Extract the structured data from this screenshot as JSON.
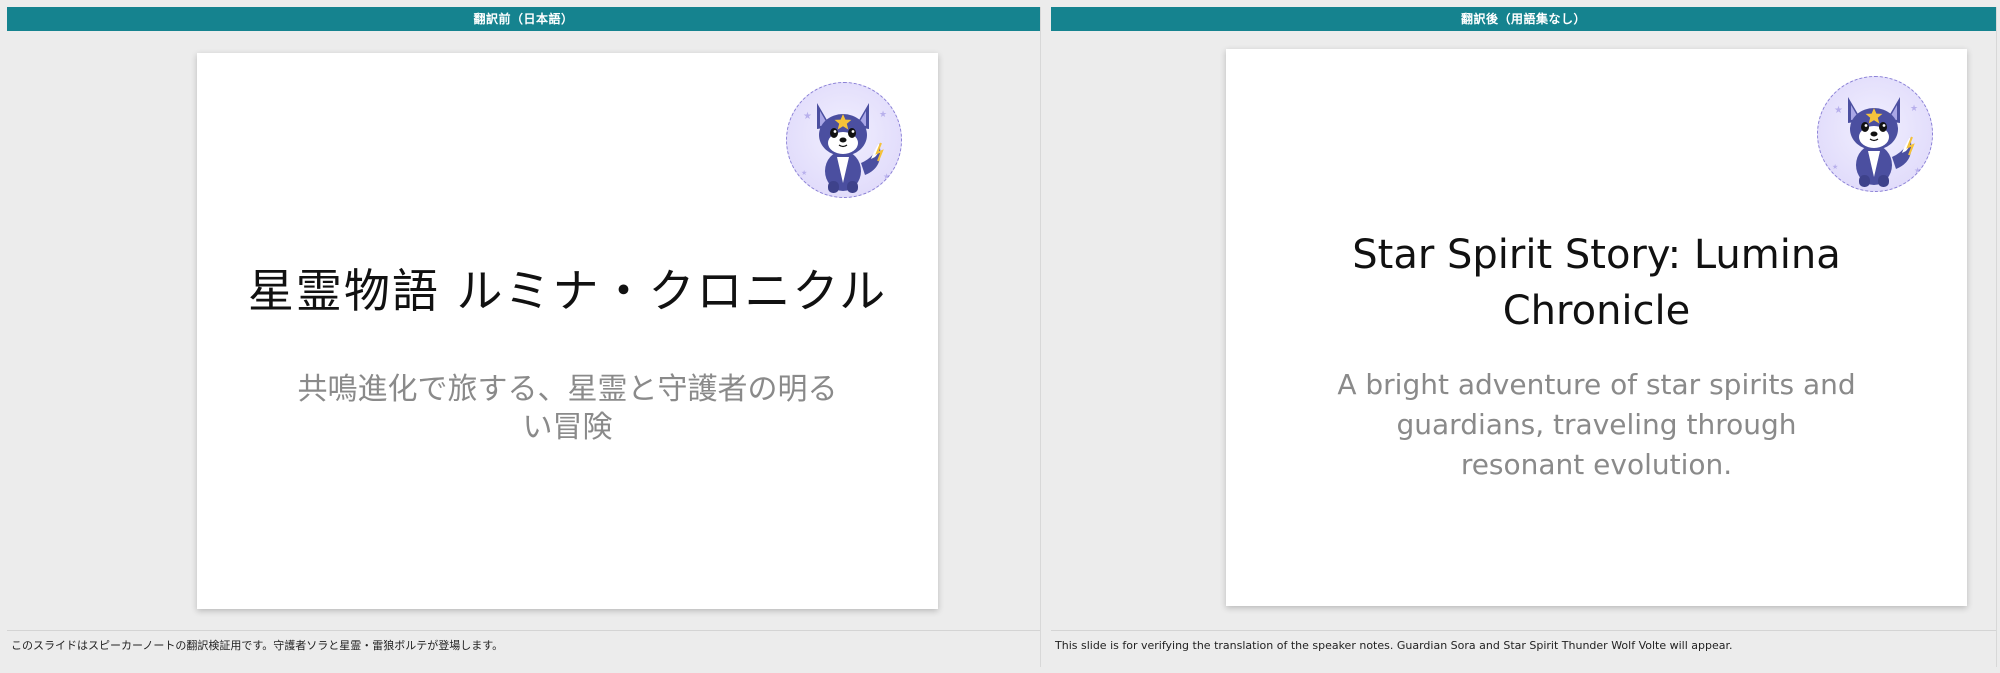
{
  "left_panel": {
    "header": "翻訳前（日本語）",
    "slide": {
      "title": "星霊物語 ルミナ・クロニクル",
      "subtitle": "共鳴進化で旅する、星霊と守護者の明るい冒険"
    },
    "notes": "このスライドはスピーカーノートの翻訳検証用です。守護者ソラと星霊・雷狼ボルテが登場します。"
  },
  "right_panel": {
    "header": "翻訳後（用語集なし）",
    "slide": {
      "title": "Star Spirit Story: Lumina Chronicle",
      "subtitle": "A bright adventure of star spirits and guardians, traveling through resonant evolution."
    },
    "notes": "This slide is for verifying the translation of the speaker notes. Guardian Sora and Star Spirit Thunder Wolf Volte will appear."
  },
  "colors": {
    "header_bg": "#15838f",
    "header_text": "#ffffff",
    "title_text": "#111111",
    "subtitle_text": "#8a8a8a",
    "workspace_bg": "#ececec",
    "mascot_fur": "#4b4fa0",
    "mascot_star": "#f5c23a"
  },
  "icons": {
    "mascot": "thunder-wolf-mascot-icon"
  }
}
